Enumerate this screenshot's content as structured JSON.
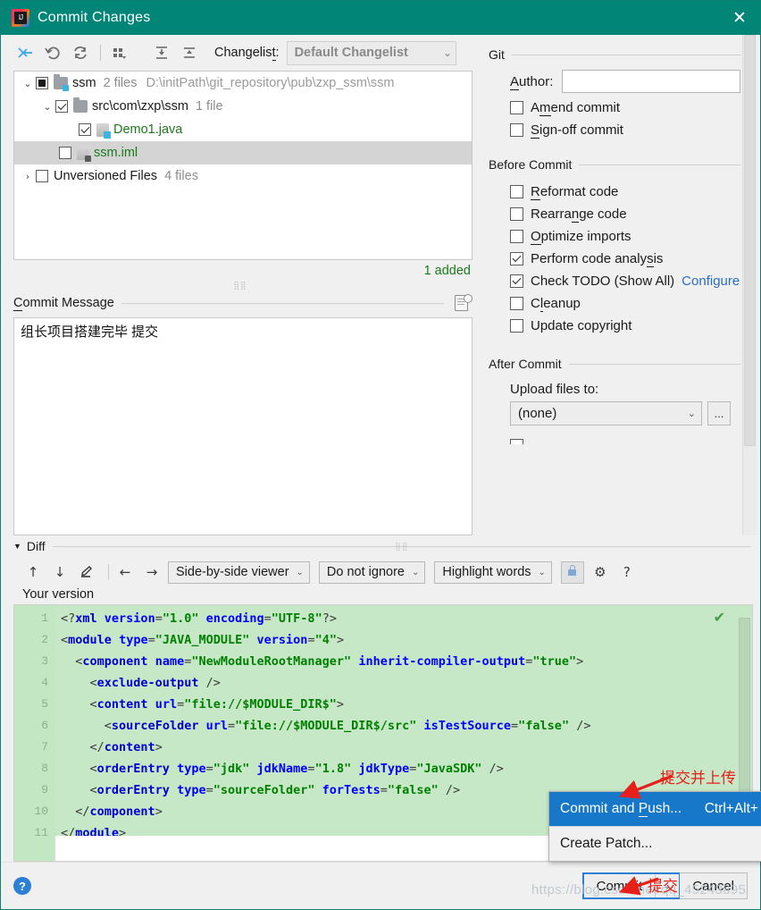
{
  "window": {
    "title": "Commit Changes",
    "close_label": "✕",
    "app_icon": "intellij-idea-icon"
  },
  "changes_toolbar": {
    "buttons": [
      {
        "name": "show-diff-icon",
        "glyph": "⇥"
      },
      {
        "name": "revert-icon",
        "glyph": "↺"
      },
      {
        "name": "refresh-icon",
        "glyph": "⟳"
      },
      {
        "name": "group-by-icon",
        "glyph": "▦"
      },
      {
        "name": "expand-all-icon",
        "glyph": "⤓"
      },
      {
        "name": "collapse-all-icon",
        "glyph": "⤒"
      }
    ],
    "changelist_label": "Changelist:",
    "changelist_value": "Default Changelist",
    "chevron": "⌄"
  },
  "tree": {
    "rows": [
      {
        "twist": "⌄",
        "check": "partial",
        "icon": "folder-vcs",
        "name": "ssm",
        "name_color": "plain",
        "count": "2 files",
        "path": "D:\\initPath\\git_repository\\pub\\zxp_ssm\\ssm",
        "indent": 0,
        "selected": false
      },
      {
        "twist": "⌄",
        "check": "checked",
        "icon": "folder",
        "name": "src\\com\\zxp\\ssm",
        "name_color": "plain",
        "count": "1 file",
        "path": "",
        "indent": 1,
        "selected": false
      },
      {
        "twist": "",
        "check": "checked",
        "icon": "java",
        "name": "Demo1.java",
        "name_color": "green",
        "count": "",
        "path": "",
        "indent": 2,
        "selected": false
      },
      {
        "twist": "",
        "check": "unchecked",
        "icon": "iml",
        "name": "ssm.iml",
        "name_color": "green",
        "count": "",
        "path": "",
        "indent": 1,
        "selected": true
      },
      {
        "twist": "›",
        "check": "unchecked",
        "icon": "none",
        "name": "Unversioned Files",
        "name_color": "plain",
        "count": "4 files",
        "path": "",
        "indent": 0,
        "selected": false
      }
    ],
    "added_summary": "1 added"
  },
  "commit_message": {
    "label_prefix": "C",
    "label_rest": "ommit Message",
    "value": "组长项目搭建完毕 提交",
    "history_icon": "message-history-icon"
  },
  "git_panel": {
    "group_git": "Git",
    "author_label_prefix": "A",
    "author_label_rest": "uthor:",
    "author_value": "",
    "checkboxes_git": [
      {
        "name": "amend-commit",
        "prefix": "A",
        "under": "m",
        "rest": "end commit",
        "checked": false
      },
      {
        "name": "sign-off-commit",
        "prefix": "",
        "under": "S",
        "rest": "ign-off commit",
        "checked": false
      }
    ],
    "group_before": "Before Commit",
    "checkboxes_before": [
      {
        "name": "reformat-code",
        "prefix": "",
        "under": "R",
        "rest": "eformat code",
        "checked": false
      },
      {
        "name": "rearrange-code",
        "prefix": "Rearra",
        "under": "n",
        "rest": "ge code",
        "checked": false
      },
      {
        "name": "optimize-imports",
        "prefix": "",
        "under": "O",
        "rest": "ptimize imports",
        "checked": false
      },
      {
        "name": "perform-code-analysis",
        "prefix": "Perform code analy",
        "under": "s",
        "rest": "is",
        "checked": true
      },
      {
        "name": "check-todo",
        "prefix": "Check TODO (Show All)",
        "under": "",
        "rest": "",
        "checked": true
      },
      {
        "name": "cleanup",
        "prefix": "C",
        "under": "l",
        "rest": "eanup",
        "checked": false
      },
      {
        "name": "update-copyright",
        "prefix": "Update copyright",
        "under": "",
        "rest": "",
        "checked": false
      }
    ],
    "configure_link": "Configure",
    "group_after": "After Commit",
    "upload_label": "Upload files to:",
    "upload_value": "(none)",
    "upload_chevron": "⌄",
    "browse_button": "..."
  },
  "diff": {
    "section_label": "Diff",
    "collapse_triangle": "▼",
    "toolbar": {
      "prev_icon": "↑",
      "next_icon": "↓",
      "edit_icon": "✎",
      "left_icon": "←",
      "right_icon": "→",
      "viewer_mode": "Side-by-side viewer",
      "ignore_mode": "Do not ignore",
      "highlight_mode": "Highlight words",
      "chevron": "⌄",
      "lock_icon": "lock-icon",
      "settings_icon": "⚙",
      "help_icon": "?"
    },
    "your_version_label": "Your version",
    "lines": [
      {
        "n": "1",
        "indent": 0,
        "tokens": [
          {
            "t": "br",
            "v": "<?"
          },
          {
            "t": "kw",
            "v": "xml"
          },
          {
            "t": "pl",
            "v": " "
          },
          {
            "t": "pn",
            "v": "version"
          },
          {
            "t": "br",
            "v": "="
          },
          {
            "t": "st",
            "v": "\"1.0\""
          },
          {
            "t": "pl",
            "v": " "
          },
          {
            "t": "pn",
            "v": "encoding"
          },
          {
            "t": "br",
            "v": "="
          },
          {
            "t": "st",
            "v": "\"UTF-8\""
          },
          {
            "t": "br",
            "v": "?>"
          }
        ]
      },
      {
        "n": "2",
        "indent": 0,
        "tokens": [
          {
            "t": "br",
            "v": "<"
          },
          {
            "t": "kw",
            "v": "module"
          },
          {
            "t": "pl",
            "v": " "
          },
          {
            "t": "pn",
            "v": "type"
          },
          {
            "t": "br",
            "v": "="
          },
          {
            "t": "st",
            "v": "\"JAVA_MODULE\""
          },
          {
            "t": "pl",
            "v": " "
          },
          {
            "t": "pn",
            "v": "version"
          },
          {
            "t": "br",
            "v": "="
          },
          {
            "t": "st",
            "v": "\"4\""
          },
          {
            "t": "br",
            "v": ">"
          }
        ]
      },
      {
        "n": "3",
        "indent": 1,
        "tokens": [
          {
            "t": "br",
            "v": "<"
          },
          {
            "t": "kw",
            "v": "component"
          },
          {
            "t": "pl",
            "v": " "
          },
          {
            "t": "pn",
            "v": "name"
          },
          {
            "t": "br",
            "v": "="
          },
          {
            "t": "st",
            "v": "\"NewModuleRootManager\""
          },
          {
            "t": "pl",
            "v": " "
          },
          {
            "t": "pn",
            "v": "inherit-compiler-output"
          },
          {
            "t": "br",
            "v": "="
          },
          {
            "t": "st",
            "v": "\"true\""
          },
          {
            "t": "br",
            "v": ">"
          }
        ]
      },
      {
        "n": "4",
        "indent": 2,
        "tokens": [
          {
            "t": "br",
            "v": "<"
          },
          {
            "t": "kw",
            "v": "exclude-output"
          },
          {
            "t": "br",
            "v": " />"
          }
        ]
      },
      {
        "n": "5",
        "indent": 2,
        "tokens": [
          {
            "t": "br",
            "v": "<"
          },
          {
            "t": "kw",
            "v": "content"
          },
          {
            "t": "pl",
            "v": " "
          },
          {
            "t": "pn",
            "v": "url"
          },
          {
            "t": "br",
            "v": "="
          },
          {
            "t": "st",
            "v": "\"file://$MODULE_DIR$\""
          },
          {
            "t": "br",
            "v": ">"
          }
        ]
      },
      {
        "n": "6",
        "indent": 3,
        "tokens": [
          {
            "t": "br",
            "v": "<"
          },
          {
            "t": "kw",
            "v": "sourceFolder"
          },
          {
            "t": "pl",
            "v": " "
          },
          {
            "t": "pn",
            "v": "url"
          },
          {
            "t": "br",
            "v": "="
          },
          {
            "t": "st",
            "v": "\"file://$MODULE_DIR$/src\""
          },
          {
            "t": "pl",
            "v": " "
          },
          {
            "t": "pn",
            "v": "isTestSource"
          },
          {
            "t": "br",
            "v": "="
          },
          {
            "t": "st",
            "v": "\"false\""
          },
          {
            "t": "br",
            "v": " />"
          }
        ]
      },
      {
        "n": "7",
        "indent": 2,
        "tokens": [
          {
            "t": "br",
            "v": "</"
          },
          {
            "t": "kw",
            "v": "content"
          },
          {
            "t": "br",
            "v": ">"
          }
        ]
      },
      {
        "n": "8",
        "indent": 2,
        "tokens": [
          {
            "t": "br",
            "v": "<"
          },
          {
            "t": "kw",
            "v": "orderEntry"
          },
          {
            "t": "pl",
            "v": " "
          },
          {
            "t": "pn",
            "v": "type"
          },
          {
            "t": "br",
            "v": "="
          },
          {
            "t": "st",
            "v": "\"jdk\""
          },
          {
            "t": "pl",
            "v": " "
          },
          {
            "t": "pn",
            "v": "jdkName"
          },
          {
            "t": "br",
            "v": "="
          },
          {
            "t": "st",
            "v": "\"1.8\""
          },
          {
            "t": "pl",
            "v": " "
          },
          {
            "t": "pn",
            "v": "jdkType"
          },
          {
            "t": "br",
            "v": "="
          },
          {
            "t": "st",
            "v": "\"JavaSDK\""
          },
          {
            "t": "br",
            "v": " />"
          }
        ]
      },
      {
        "n": "9",
        "indent": 2,
        "tokens": [
          {
            "t": "br",
            "v": "<"
          },
          {
            "t": "kw",
            "v": "orderEntry"
          },
          {
            "t": "pl",
            "v": " "
          },
          {
            "t": "pn",
            "v": "type"
          },
          {
            "t": "br",
            "v": "="
          },
          {
            "t": "st",
            "v": "\"sourceFolder\""
          },
          {
            "t": "pl",
            "v": " "
          },
          {
            "t": "pn",
            "v": "forTests"
          },
          {
            "t": "br",
            "v": "="
          },
          {
            "t": "st",
            "v": "\"false\""
          },
          {
            "t": "br",
            "v": " />"
          }
        ]
      },
      {
        "n": "10",
        "indent": 1,
        "tokens": [
          {
            "t": "br",
            "v": "</"
          },
          {
            "t": "kw",
            "v": "component"
          },
          {
            "t": "br",
            "v": ">"
          }
        ]
      },
      {
        "n": "11",
        "indent": 0,
        "tokens": [
          {
            "t": "br",
            "v": "</"
          },
          {
            "t": "kw",
            "v": "module"
          },
          {
            "t": "br",
            "v": ">"
          }
        ]
      }
    ]
  },
  "popup_menu": {
    "items": [
      {
        "name": "commit-and-push",
        "prefix": "Commit and ",
        "under": "P",
        "rest": "ush...",
        "shortcut": "Ctrl+Alt+",
        "highlighted": true
      },
      {
        "name": "create-patch",
        "prefix": "Create Patch...",
        "under": "",
        "rest": "",
        "shortcut": "",
        "highlighted": false
      }
    ]
  },
  "bottom_bar": {
    "help_label": "?",
    "commit_label": "Commit",
    "commit_arrow": "⌄",
    "cancel_label": "Cancel"
  },
  "annotations": [
    {
      "name": "annotation-commit-and-push",
      "text": "提交并上传"
    },
    {
      "name": "annotation-commit",
      "text": "提交"
    }
  ],
  "watermark": "https://blog.csdn.net/qq_45243895",
  "colors": {
    "titlebar": "#008577",
    "added_green": "#1a7a1a",
    "diff_bg": "#c6e8c6",
    "highlight_blue": "#1777c8",
    "link_blue": "#2a6ebb",
    "annotation_red": "#e8201a"
  }
}
